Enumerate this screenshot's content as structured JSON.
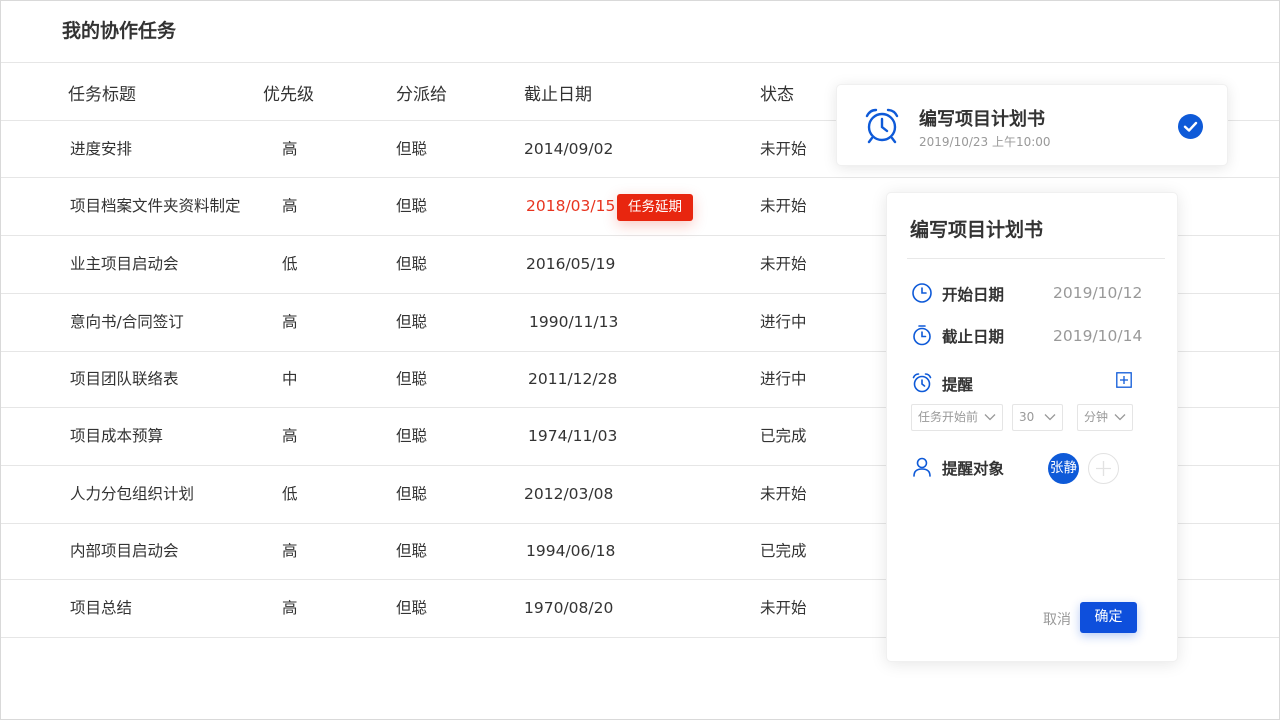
{
  "page": {
    "title": "我的协作任务"
  },
  "table": {
    "headers": [
      "任务标题",
      "优先级",
      "分派给",
      "截止日期",
      "状态"
    ],
    "rows": [
      {
        "title": "进度安排",
        "priority": "高",
        "assignee": "但聪",
        "due": "2014/09/02",
        "status": "未开始"
      },
      {
        "title": "项目档案文件夹资料制定",
        "priority": "高",
        "assignee": "但聪",
        "due": "2018/03/15",
        "status": "未开始",
        "overdue": true,
        "badge": "任务延期"
      },
      {
        "title": "业主项目启动会",
        "priority": "低",
        "assignee": "但聪",
        "due": "2016/05/19",
        "status": "未开始"
      },
      {
        "title": "意向书/合同签订",
        "priority": "高",
        "assignee": "但聪",
        "due": "1990/11/13",
        "status": "进行中"
      },
      {
        "title": "项目团队联络表",
        "priority": "中",
        "assignee": "但聪",
        "due": "2011/12/28",
        "status": "进行中"
      },
      {
        "title": "项目成本预算",
        "priority": "高",
        "assignee": "但聪",
        "due": "1974/11/03",
        "status": "已完成"
      },
      {
        "title": "人力分包组织计划",
        "priority": "低",
        "assignee": "但聪",
        "due": "2012/03/08",
        "status": "未开始"
      },
      {
        "title": "内部项目启动会",
        "priority": "高",
        "assignee": "但聪",
        "due": "1994/06/18",
        "status": "已完成"
      },
      {
        "title": "项目总结",
        "priority": "高",
        "assignee": "但聪",
        "due": "1970/08/20",
        "status": "未开始"
      }
    ]
  },
  "notification": {
    "title": "编写项目计划书",
    "time": "2019/10/23 上午10:00",
    "icon": "alarm-clock-icon",
    "checked": true
  },
  "detail": {
    "title": "编写项目计划书",
    "start_label": "开始日期",
    "start_value": "2019/10/12",
    "due_label": "截止日期",
    "due_value": "2019/10/14",
    "reminder_label": "提醒",
    "reminder_when": "任务开始前",
    "reminder_amount": "30",
    "reminder_unit": "分钟",
    "target_label": "提醒对象",
    "target_user": "张静",
    "cancel": "取消",
    "confirm": "确定"
  },
  "colors": {
    "accent": "#0e5ad8",
    "danger": "#e8260f"
  }
}
